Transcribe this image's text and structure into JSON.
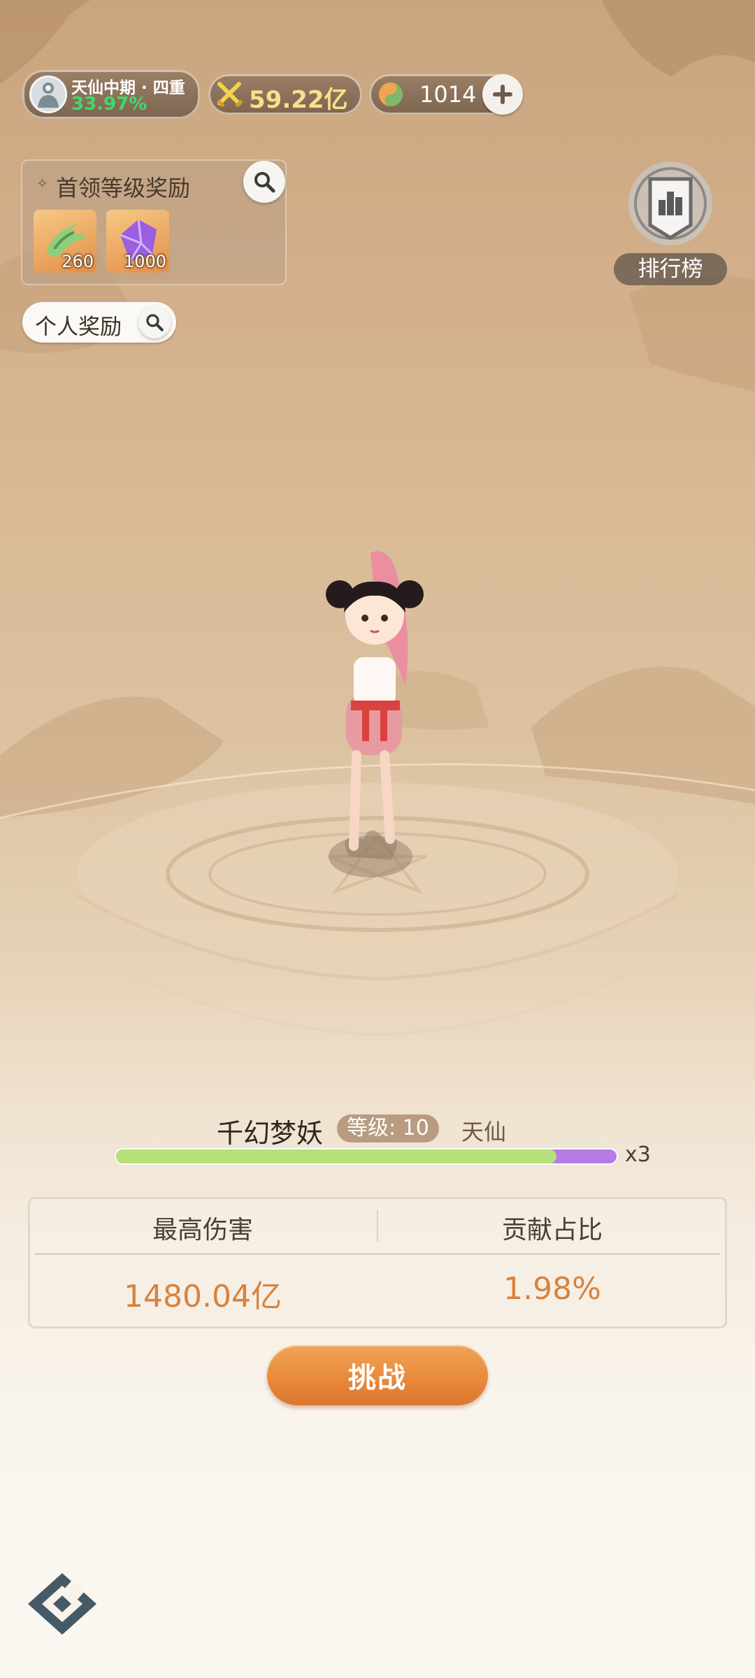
{
  "header": {
    "realm_title": "天仙中期 · 四重",
    "realm_progress": "33.97%",
    "power_value": "59.22亿",
    "currency_value": "1014"
  },
  "boss_rewards": {
    "title": "首领等级奖励",
    "items": [
      {
        "icon": "dragon-bone-icon",
        "count": "260"
      },
      {
        "icon": "purple-crystal-icon",
        "count": "1000"
      }
    ]
  },
  "personal_rewards": {
    "label": "个人奖励"
  },
  "ranking": {
    "label": "排行榜"
  },
  "boss": {
    "name": "千幻梦妖",
    "level_label": "等级: 10",
    "realm": "天仙",
    "health_fraction": 0.88,
    "bar_count": "x3"
  },
  "stats": {
    "max_damage_label": "最高伤害",
    "max_damage_value": "1480.04亿",
    "contribution_label": "贡献占比",
    "contribution_value": "1.98%"
  },
  "challenge_button": {
    "label": "挑战"
  },
  "colors": {
    "accent_orange": "#e98a3c",
    "value_orange": "#d9823c",
    "progress_green": "#41d86b",
    "health_green": "#b6e07a",
    "health_purple": "#b87be6"
  }
}
